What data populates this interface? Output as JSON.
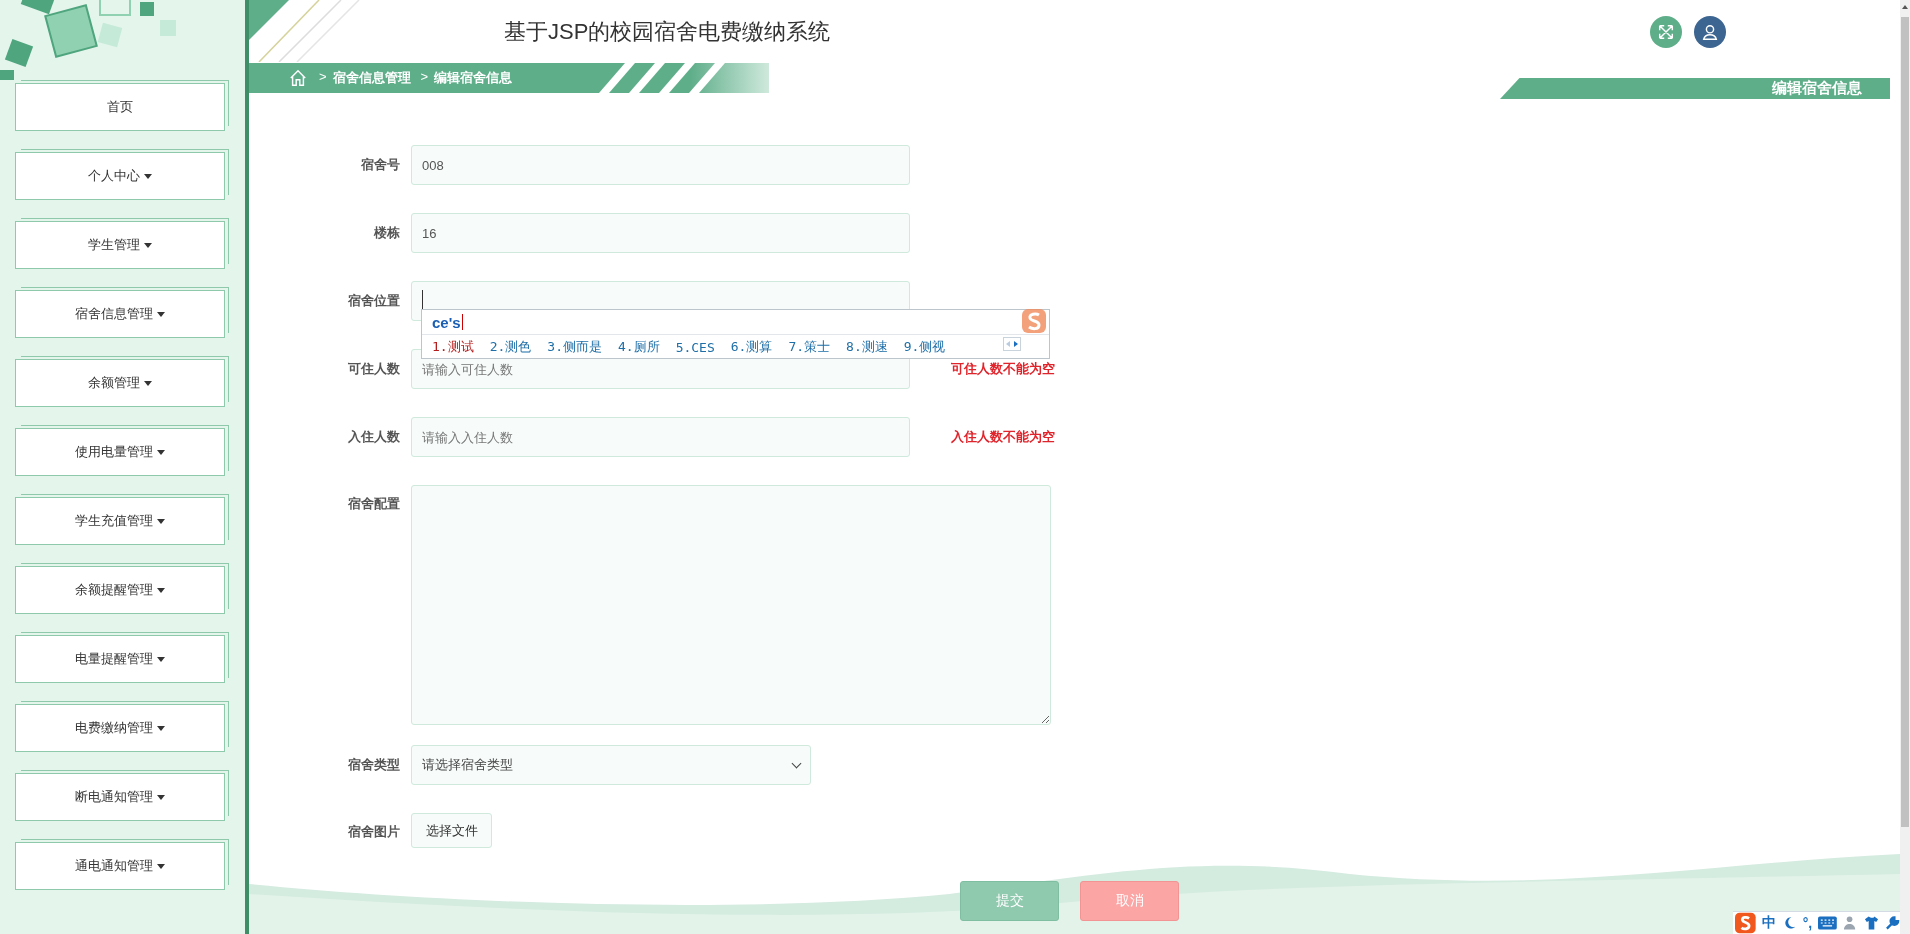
{
  "header": {
    "title": "基于JSP的校园宿舍电费缴纳系统",
    "breadcrumb_separator": ">",
    "breadcrumb": [
      "宿舍信息管理",
      "编辑宿舍信息"
    ],
    "page_title": "编辑宿舍信息"
  },
  "sidebar": {
    "items": [
      {
        "label": "首页",
        "has_menu": false
      },
      {
        "label": "个人中心",
        "has_menu": true
      },
      {
        "label": "学生管理",
        "has_menu": true
      },
      {
        "label": "宿舍信息管理",
        "has_menu": true
      },
      {
        "label": "余额管理",
        "has_menu": true
      },
      {
        "label": "使用电量管理",
        "has_menu": true
      },
      {
        "label": "学生充值管理",
        "has_menu": true
      },
      {
        "label": "余额提醒管理",
        "has_menu": true
      },
      {
        "label": "电量提醒管理",
        "has_menu": true
      },
      {
        "label": "电费缴纳管理",
        "has_menu": true
      },
      {
        "label": "断电通知管理",
        "has_menu": true
      },
      {
        "label": "通电通知管理",
        "has_menu": true
      }
    ]
  },
  "form": {
    "fields": [
      {
        "kind": "text",
        "label": "宿舍号",
        "value": "008",
        "focused": false
      },
      {
        "kind": "text",
        "label": "楼栋",
        "value": "16",
        "focused": false
      },
      {
        "kind": "text",
        "label": "宿舍位置",
        "focused": true
      },
      {
        "kind": "text",
        "label": "可住人数",
        "placeholder": "请输入可住人数",
        "error": "可住人数不能为空",
        "focused": false
      },
      {
        "kind": "text",
        "label": "入住人数",
        "placeholder": "请输入入住人数",
        "error": "入住人数不能为空",
        "focused": false
      },
      {
        "kind": "textarea",
        "label": "宿舍配置"
      },
      {
        "kind": "select",
        "label": "宿舍类型",
        "placeholder": "请选择宿舍类型"
      },
      {
        "kind": "file",
        "label": "宿舍图片",
        "button_label": "选择文件"
      }
    ],
    "buttons": [
      {
        "label": "提交",
        "kind": "submit"
      },
      {
        "label": "取消",
        "kind": "cancel"
      }
    ]
  },
  "ime": {
    "input": "ce's",
    "candidates": [
      {
        "label": "1.测试",
        "selected": true
      },
      {
        "label": "2.测色",
        "selected": false
      },
      {
        "label": "3.侧而是",
        "selected": false
      },
      {
        "label": "4.厕所",
        "selected": false
      },
      {
        "label": "5.CES",
        "selected": false
      },
      {
        "label": "6.测算",
        "selected": false
      },
      {
        "label": "7.策士",
        "selected": false
      },
      {
        "label": "8.测速",
        "selected": false
      },
      {
        "label": "9.侧视",
        "selected": false
      }
    ],
    "toolbar": {
      "mode": "中",
      "punctuation": "°,"
    }
  }
}
